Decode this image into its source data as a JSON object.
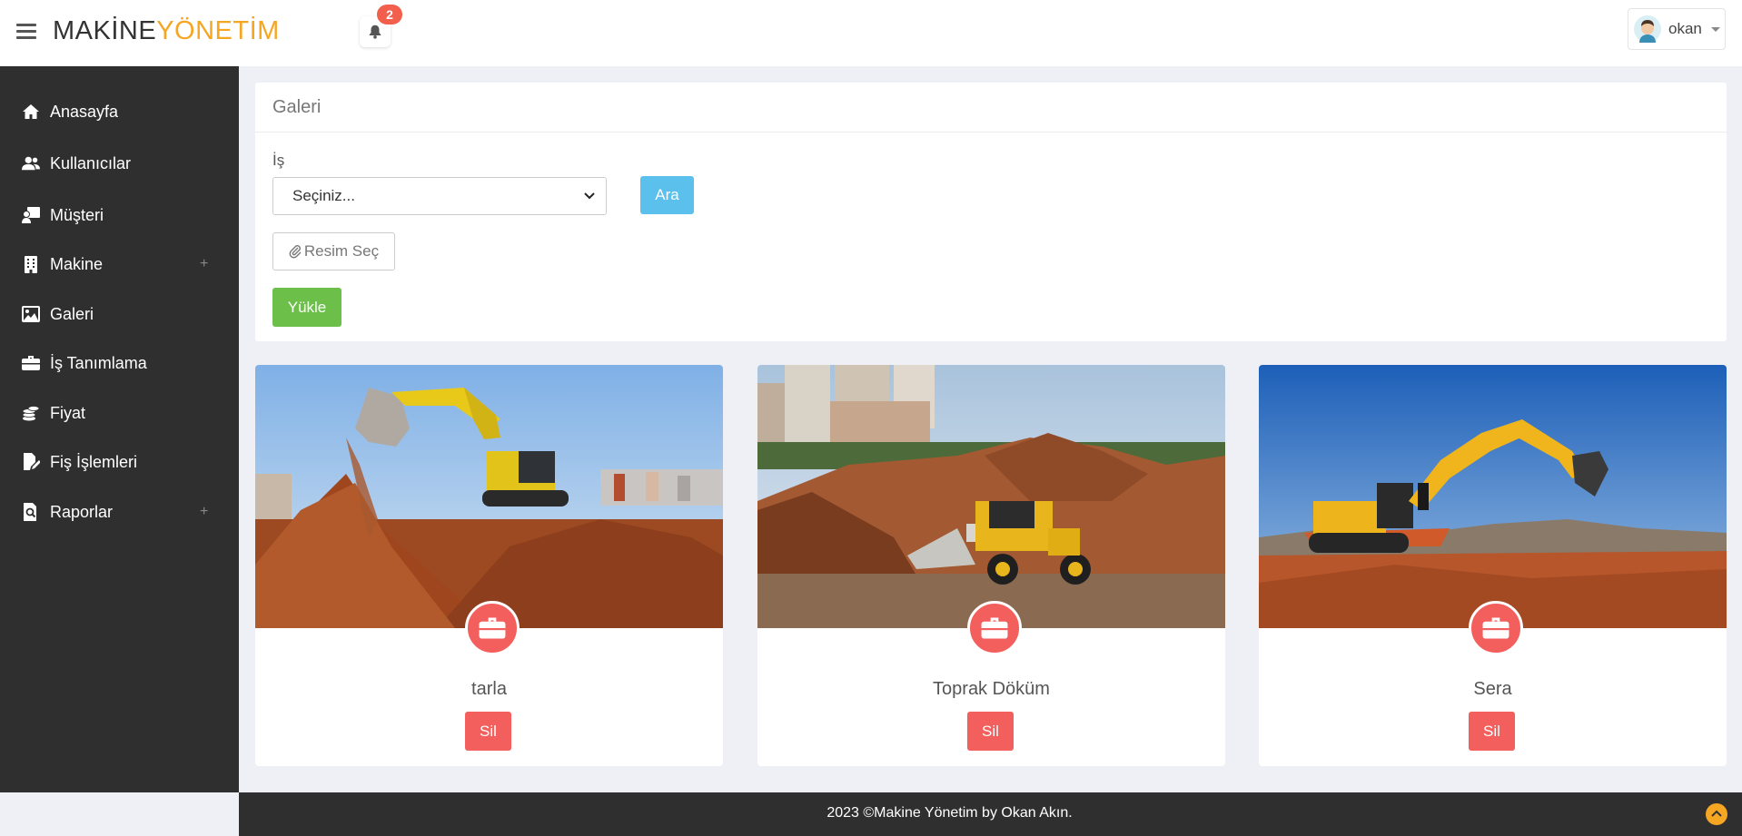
{
  "header": {
    "brand_part1": "MAKİNE",
    "brand_part2": "YÖNETİM",
    "notification_count": "2",
    "user_name": "okan"
  },
  "sidebar": {
    "items": [
      {
        "label": "Anasayfa",
        "icon": "home-icon"
      },
      {
        "label": "Kullanıcılar",
        "icon": "users-icon"
      },
      {
        "label": "Müşteri",
        "icon": "customer-icon"
      },
      {
        "label": "Makine",
        "icon": "building-icon",
        "expandable": "+"
      },
      {
        "label": "Galeri",
        "icon": "image-icon"
      },
      {
        "label": "İş Tanımlama",
        "icon": "briefcase-icon"
      },
      {
        "label": "Fiyat",
        "icon": "coins-icon"
      },
      {
        "label": "Fiş İşlemleri",
        "icon": "edit-document-icon"
      },
      {
        "label": "Raporlar",
        "icon": "report-search-icon",
        "expandable": "+"
      }
    ]
  },
  "panel": {
    "title": "Galeri",
    "field_label": "İş",
    "select_value": "Seçiniz...",
    "search_button": "Ara",
    "choose_image_button": "Resim Seç",
    "upload_button": "Yükle"
  },
  "cards": [
    {
      "title": "tarla",
      "delete_label": "Sil"
    },
    {
      "title": "Toprak Döküm",
      "delete_label": "Sil"
    },
    {
      "title": "Sera",
      "delete_label": "Sil"
    }
  ],
  "footer": {
    "text": "2023 ©Makine Yönetim by Okan Akın."
  },
  "colors": {
    "accent": "#f5a623",
    "sidebar_bg": "#2f2f30",
    "info": "#5bc0eb",
    "success": "#6cc04a",
    "danger": "#f25f5c"
  }
}
